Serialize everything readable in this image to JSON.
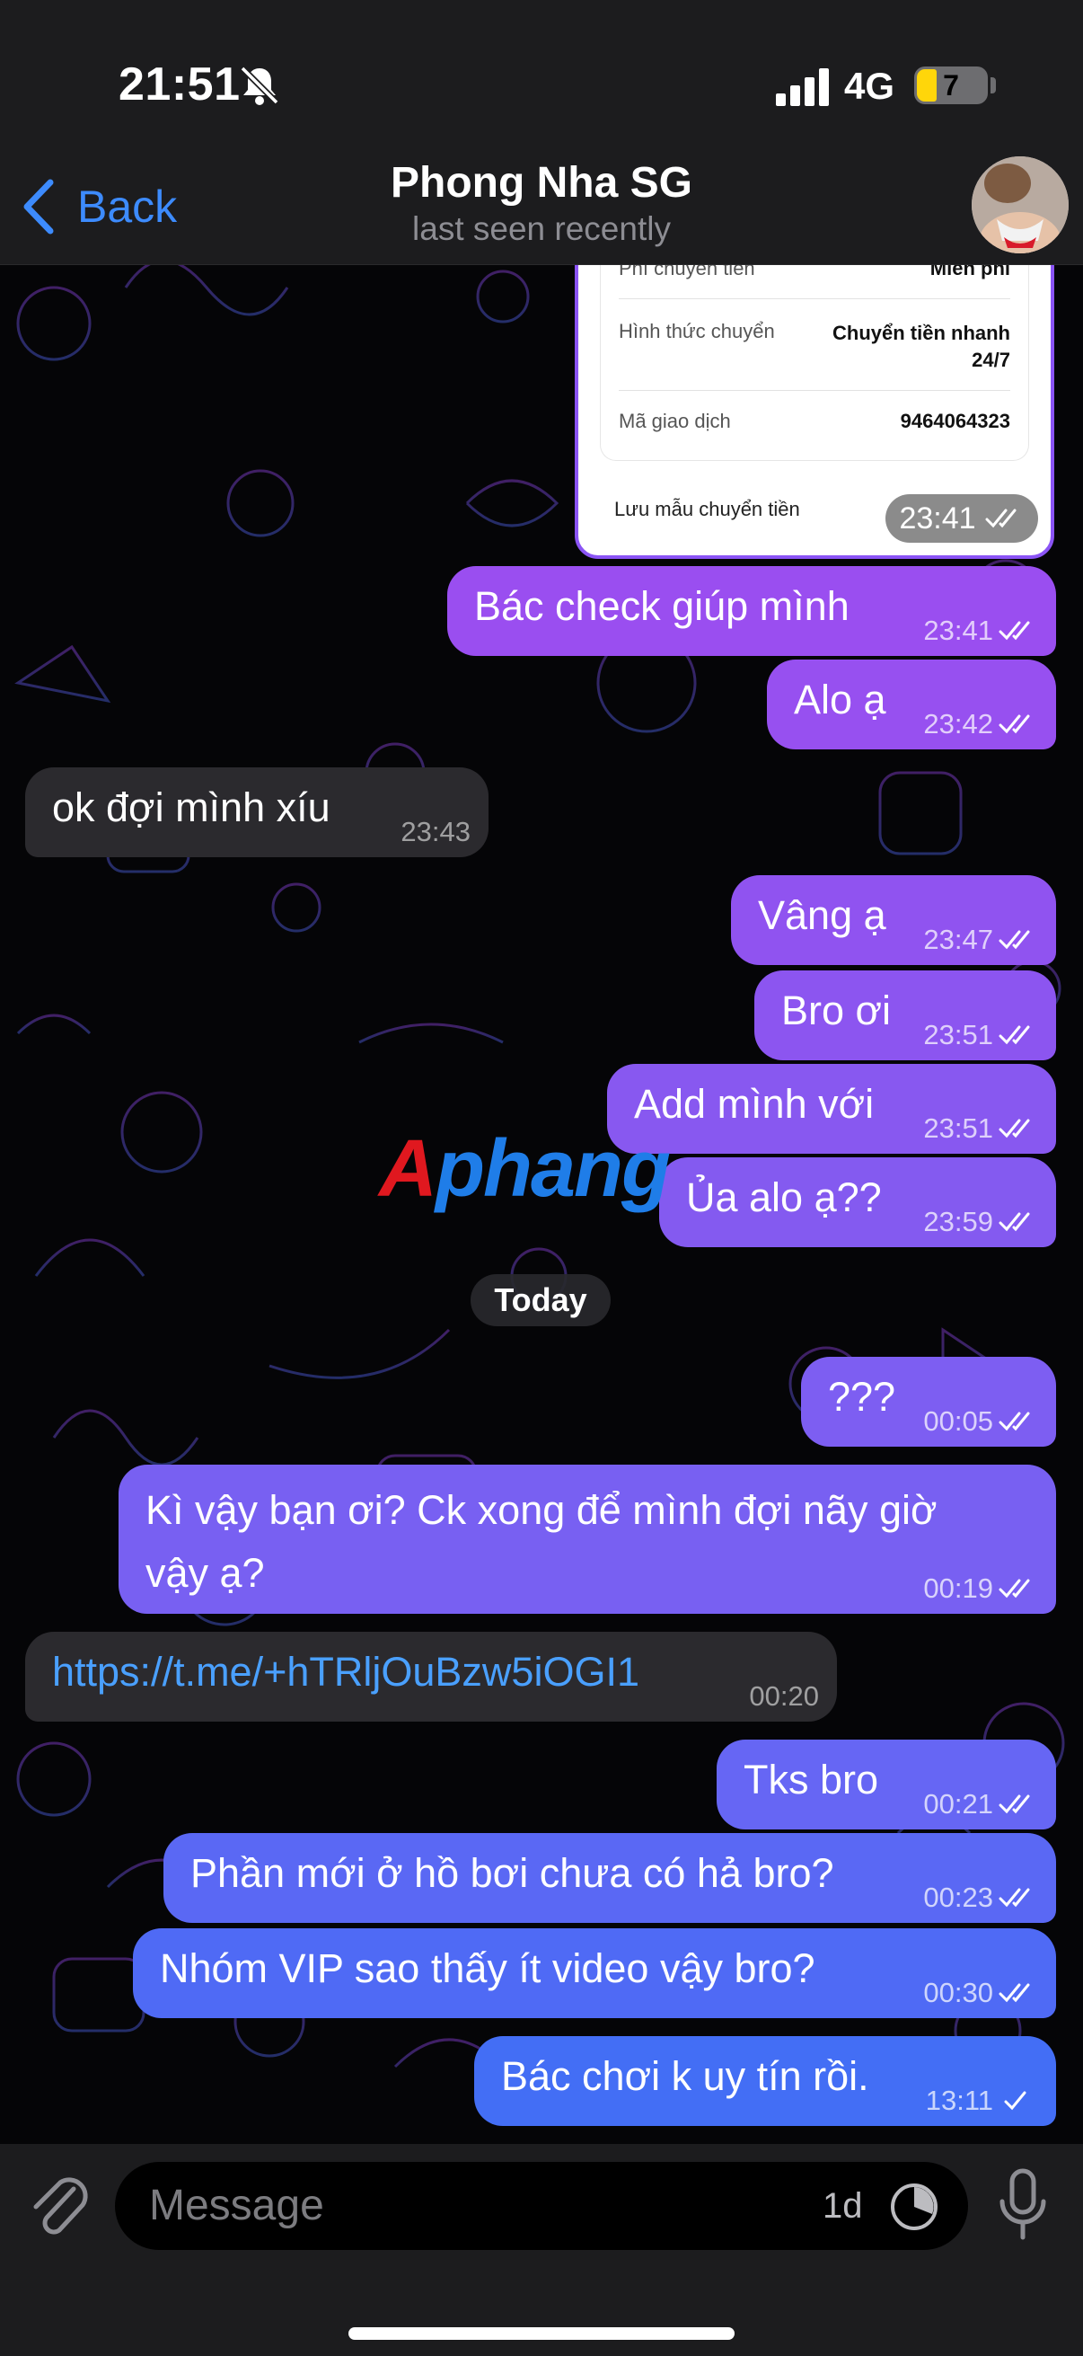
{
  "status_bar": {
    "time": "21:51",
    "network": "4G",
    "battery": "7"
  },
  "header": {
    "back_label": "Back",
    "title": "Phong Nha SG",
    "subtitle": "last seen recently"
  },
  "receipt": {
    "rows": [
      {
        "label": "Phí chuyển tiền",
        "value": "Miễn phí"
      },
      {
        "label": "Hình thức chuyển",
        "value_line1": "Chuyển tiền nhanh",
        "value_line2": "24/7"
      },
      {
        "label": "Mã giao dịch",
        "value": "9464064323"
      }
    ],
    "footer": "Lưu mẫu chuyển tiền",
    "time": "23:41"
  },
  "messages": [
    {
      "text": "Bác check giúp mình",
      "time": "23:41"
    },
    {
      "text": "Alo ạ",
      "time": "23:42"
    },
    {
      "text": "ok đợi mình xíu",
      "time": "23:43"
    },
    {
      "text": "Vâng ạ",
      "time": "23:47"
    },
    {
      "text": "Bro ơi",
      "time": "23:51"
    },
    {
      "text": "Add mình với",
      "time": "23:51"
    },
    {
      "text": "Ủa alo ạ??",
      "time": "23:59"
    },
    {
      "text": "???",
      "time": "00:05"
    },
    {
      "line1": "Kì vậy bạn ơi? Ck xong để mình đợi nãy giờ",
      "line2": "vậy ạ?",
      "time": "00:19"
    },
    {
      "text": "https://t.me/+hTRljOuBzw5iOGI1",
      "time": "00:20"
    },
    {
      "text": "Tks bro",
      "time": "00:21"
    },
    {
      "text": "Phần mới ở hồ bơi chưa có hả bro?",
      "time": "00:23"
    },
    {
      "text": "Nhóm VIP sao thấy ít video vậy bro?",
      "time": "00:30"
    },
    {
      "text": "Bác chơi k uy tín rồi.",
      "time": "13:11"
    }
  ],
  "day_separator": "Today",
  "watermark": {
    "part1": "A",
    "part2": "phang"
  },
  "composer": {
    "placeholder": "Message",
    "timer": "1d"
  },
  "colors": {
    "bubble_top": "#9a4ef0",
    "bubble_bottom": "#3c6cf5",
    "incoming": "#2b2a2e",
    "link": "#4aa0ff",
    "accent": "#3d8bfd"
  },
  "icons": [
    "bell-slash-icon",
    "signal-icon",
    "battery-icon",
    "chevron-left-icon",
    "double-check-icon",
    "single-check-icon",
    "paperclip-icon",
    "clock-icon",
    "microphone-icon"
  ]
}
